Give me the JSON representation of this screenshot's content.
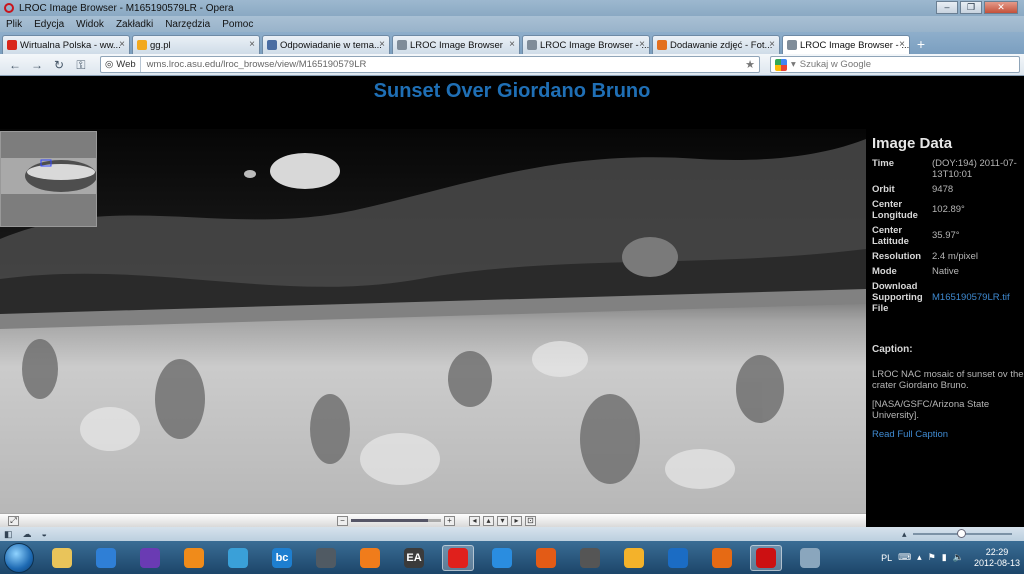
{
  "window": {
    "title": "LROC Image Browser - M165190579LR - Opera"
  },
  "menu": [
    "Plik",
    "Edycja",
    "Widok",
    "Zakładki",
    "Narzędzia",
    "Pomoc"
  ],
  "tabs": [
    {
      "label": "Wirtualna Polska - ww...",
      "color": "#d9261c"
    },
    {
      "label": "gg.pl",
      "color": "#f2a91d"
    },
    {
      "label": "Odpowiadanie w tema...",
      "color": "#4a6da3"
    },
    {
      "label": "LROC Image Browser",
      "color": "#7f8c99"
    },
    {
      "label": "LROC Image Browser - ...",
      "color": "#7f8c99"
    },
    {
      "label": "Dodawanie zdjęć - Fot...",
      "color": "#e36f1e"
    },
    {
      "label": "LROC Image Browser - ...",
      "color": "#7f8c99",
      "active": true
    }
  ],
  "address": {
    "badge": "Web",
    "url": "wms.lroc.asu.edu/lroc_browse/view/M165190579LR",
    "search_placeholder": "Szukaj w Google"
  },
  "page": {
    "title": "Sunset Over Giordano Bruno"
  },
  "image_data": {
    "heading": "Image Data",
    "rows": [
      {
        "key": "Time",
        "value": "(DOY:194) 2011-07-13T10:01"
      },
      {
        "key": "Orbit",
        "value": "9478"
      },
      {
        "key": "Center Longitude",
        "value": "102.89°"
      },
      {
        "key": "Center Latitude",
        "value": "35.97°"
      },
      {
        "key": "Resolution",
        "value": "2.4 m/pixel"
      },
      {
        "key": "Mode",
        "value": "Native"
      }
    ],
    "download_key": "Download Supporting File",
    "download_link": "M165190579LR.tif",
    "caption_heading": "Caption:",
    "caption_text": "LROC NAC mosaic of sunset ov the crater Giordano Bruno.",
    "caption_credit": "[NASA/GSFC/Arizona State University].",
    "read_full": "Read Full Caption"
  },
  "image_toolbar": {
    "zoom_fraction": 0.85
  },
  "taskbar": {
    "language": "PL",
    "time": "22:29",
    "date": "2012-08-13",
    "icons": [
      {
        "name": "explorer-icon",
        "color": "#e9c45a",
        "label": ""
      },
      {
        "name": "winamp-icon",
        "color": "#2f7fd6",
        "label": ""
      },
      {
        "name": "media-icon",
        "color": "#6a3bb3",
        "label": ""
      },
      {
        "name": "player-icon",
        "color": "#f08b1a",
        "label": ""
      },
      {
        "name": "sync-icon",
        "color": "#3aa0d8",
        "label": ""
      },
      {
        "name": "bc-icon",
        "color": "#1e7fd0",
        "label": "bc"
      },
      {
        "name": "mouse-icon",
        "color": "#505a63",
        "label": ""
      },
      {
        "name": "orange-app-icon",
        "color": "#f07c1b",
        "label": ""
      },
      {
        "name": "ea-icon",
        "color": "#3b3b3b",
        "label": "EA"
      },
      {
        "name": "red-star-icon",
        "color": "#e0201c",
        "label": "",
        "active": true
      },
      {
        "name": "blue-globe-icon",
        "color": "#2a8de0",
        "label": ""
      },
      {
        "name": "fire-icon",
        "color": "#e35b16",
        "label": ""
      },
      {
        "name": "game-icon",
        "color": "#555",
        "label": ""
      },
      {
        "name": "gg-icon",
        "color": "#f4b22a",
        "label": ""
      },
      {
        "name": "monitor-icon",
        "color": "#1b6cc4",
        "label": ""
      },
      {
        "name": "firefox-icon",
        "color": "#e66a14",
        "label": ""
      },
      {
        "name": "opera-icon",
        "color": "#cc1012",
        "label": "",
        "active": true
      },
      {
        "name": "tool-icon",
        "color": "#8aa6bd",
        "label": ""
      }
    ]
  }
}
